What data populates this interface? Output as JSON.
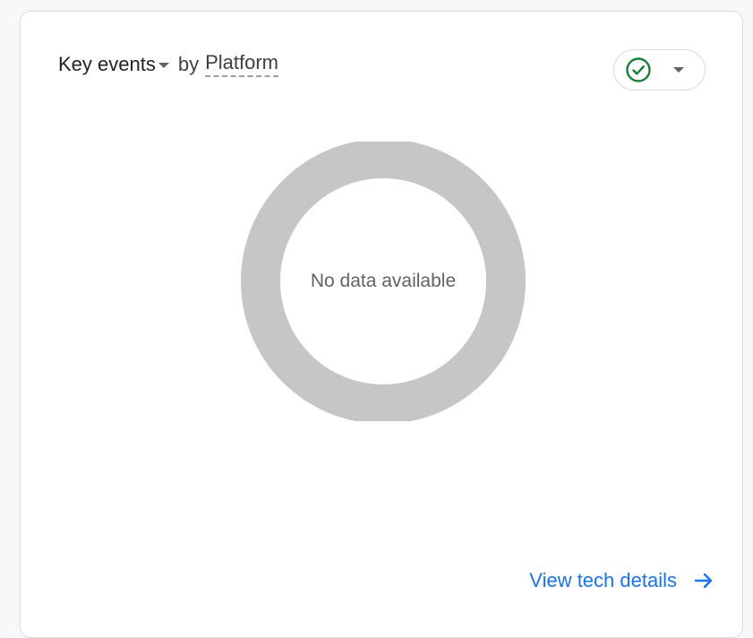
{
  "card": {
    "metric_label": "Key events",
    "by_label": "by",
    "dimension_label": "Platform",
    "status_icon": "check-circle-icon",
    "status_color": "#188038",
    "empty_message": "No data available",
    "ring_color": "#c6c6c6",
    "footer_link_label": "View tech details",
    "footer_icon": "arrow-right-icon",
    "link_color": "#1a73e8"
  }
}
